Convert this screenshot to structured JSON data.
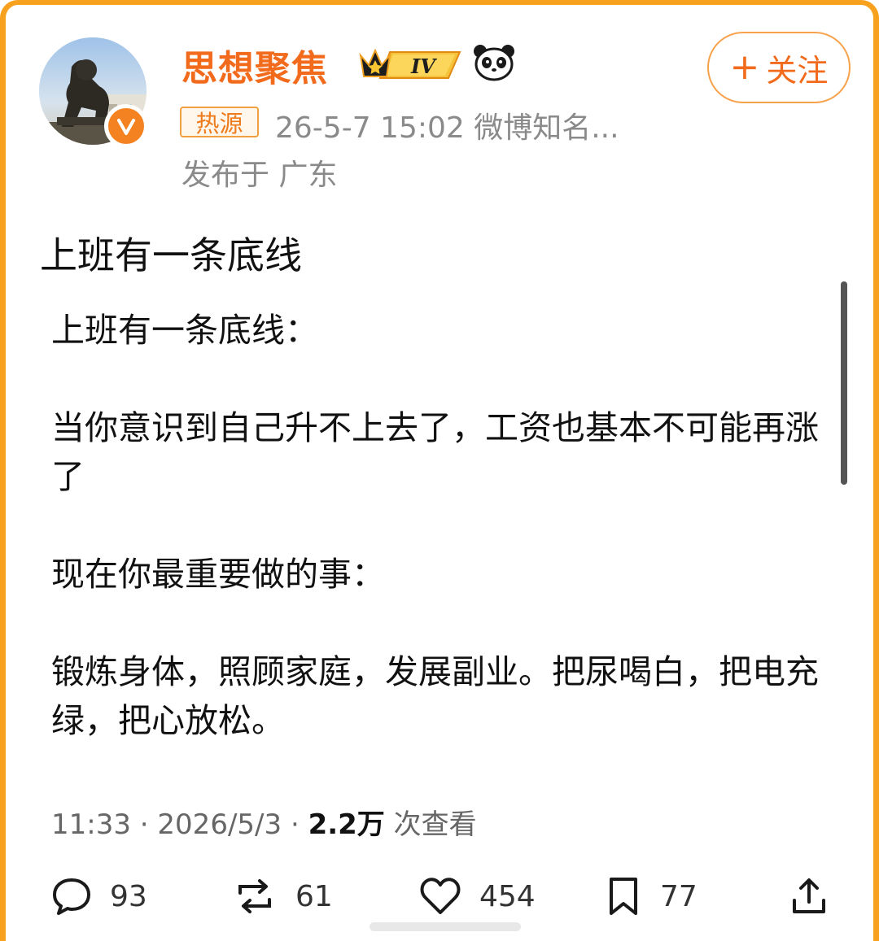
{
  "header": {
    "username": "思想聚焦",
    "vip_level": "IV",
    "follow_label": "关注",
    "hot_badge": "热源",
    "meta_text": "26-5-7 15:02  微博知名...",
    "location_text": "发布于 广东"
  },
  "post": {
    "title": "上班有一条底线",
    "paragraphs": [
      "上班有一条底线：",
      "当你意识到自己升不上去了，工资也基本不可能再涨了",
      "现在你最重要做的事：",
      "锻炼身体，照顾家庭，发展副业。把尿喝白，把电充绿，把心放松。"
    ]
  },
  "stats": {
    "time": "11:33",
    "date": "2026/5/3",
    "views": "2.2万",
    "views_suffix": "次查看"
  },
  "actions": {
    "comments": "93",
    "reposts": "61",
    "likes": "454",
    "bookmarks": "77"
  },
  "colors": {
    "frame": "#f7a11f",
    "accent": "#f26b1d",
    "meta_gray": "#8a8a8a"
  }
}
